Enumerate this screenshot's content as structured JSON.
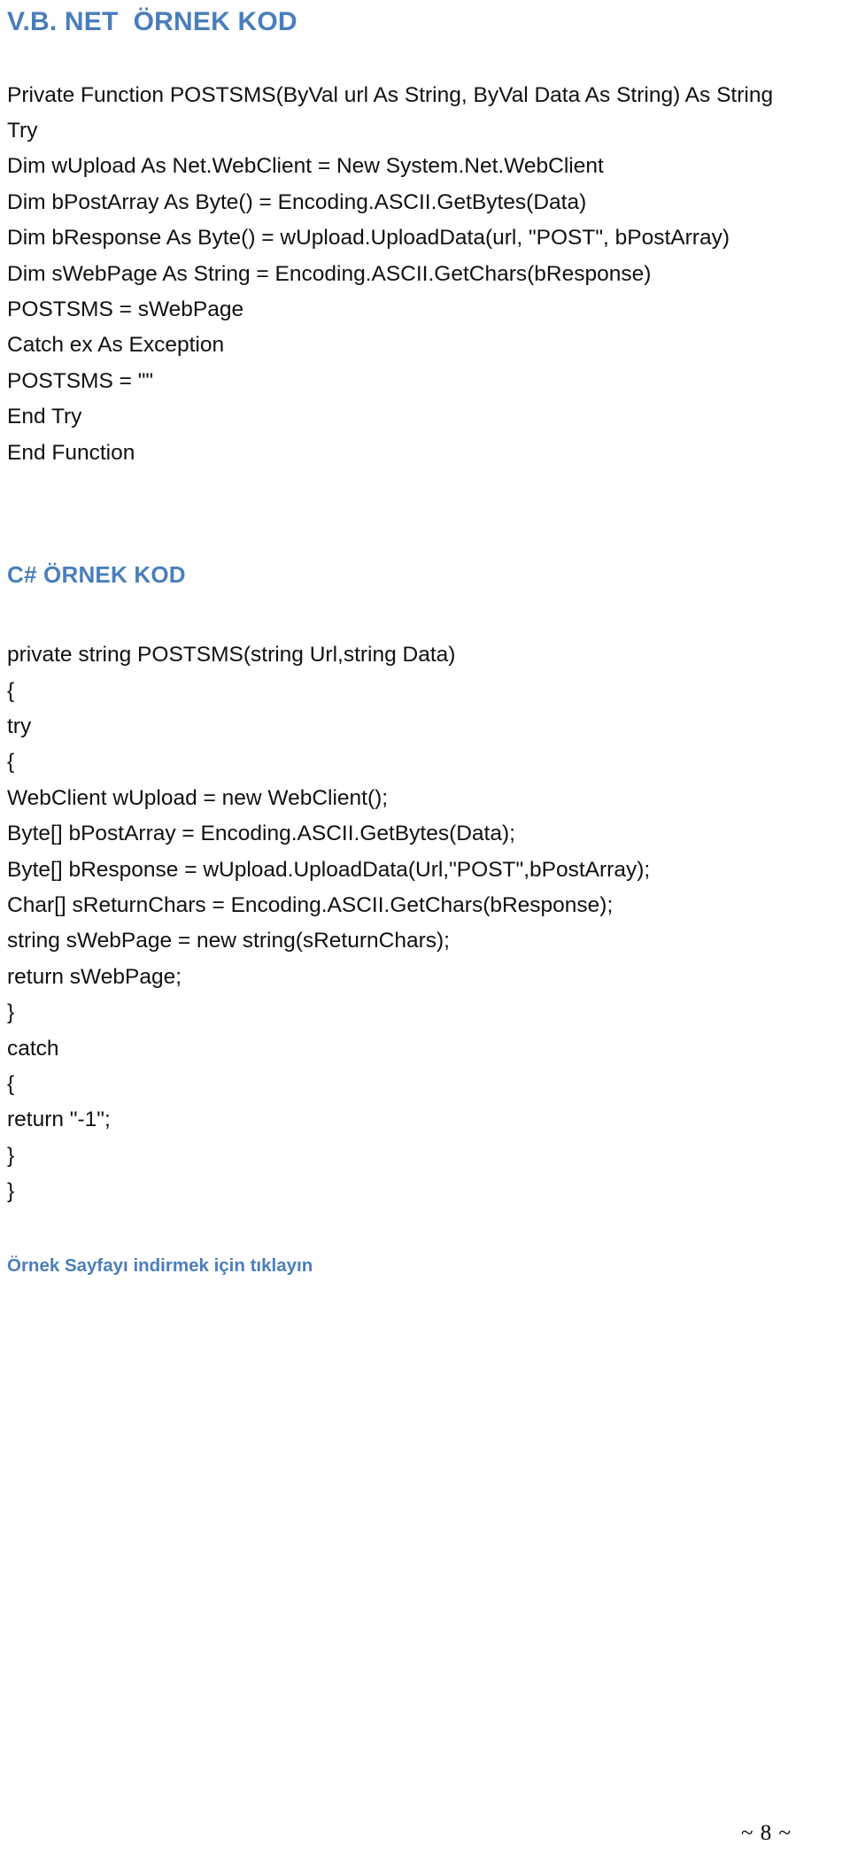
{
  "document": {
    "page_number_label": "~ 8 ~",
    "accent_color": "#4a7ebb",
    "body_color": "#111111",
    "background_color": "#ffffff"
  },
  "sections": [
    {
      "heading": "V.B. NET  ÖRNEK KOD",
      "language": "vb.net",
      "code_lines": [
        "Private Function POSTSMS(ByVal url As String, ByVal Data As String) As String",
        "Try",
        "Dim wUpload As Net.WebClient = New System.Net.WebClient",
        "Dim bPostArray As Byte() = Encoding.ASCII.GetBytes(Data)",
        "Dim bResponse As Byte() = wUpload.UploadData(url, \"POST\", bPostArray)",
        "Dim sWebPage As String = Encoding.ASCII.GetChars(bResponse)",
        "POSTSMS = sWebPage",
        "Catch ex As Exception",
        "POSTSMS = \"\"",
        "End Try",
        "End Function"
      ]
    },
    {
      "heading": "C# ÖRNEK KOD",
      "language": "csharp",
      "code_lines": [
        "private string POSTSMS(string Url,string Data)",
        "{",
        "try",
        "{",
        "WebClient wUpload = new WebClient();",
        "Byte[] bPostArray = Encoding.ASCII.GetBytes(Data);",
        "Byte[] bResponse = wUpload.UploadData(Url,\"POST\",bPostArray);",
        "Char[] sReturnChars = Encoding.ASCII.GetChars(bResponse);",
        "string sWebPage = new string(sReturnChars);",
        "return sWebPage;",
        "}",
        "catch",
        "{",
        "return \"-1\";",
        "}",
        "}"
      ]
    }
  ],
  "download_link": {
    "label": "Örnek Sayfayı indirmek için tıklayın"
  }
}
